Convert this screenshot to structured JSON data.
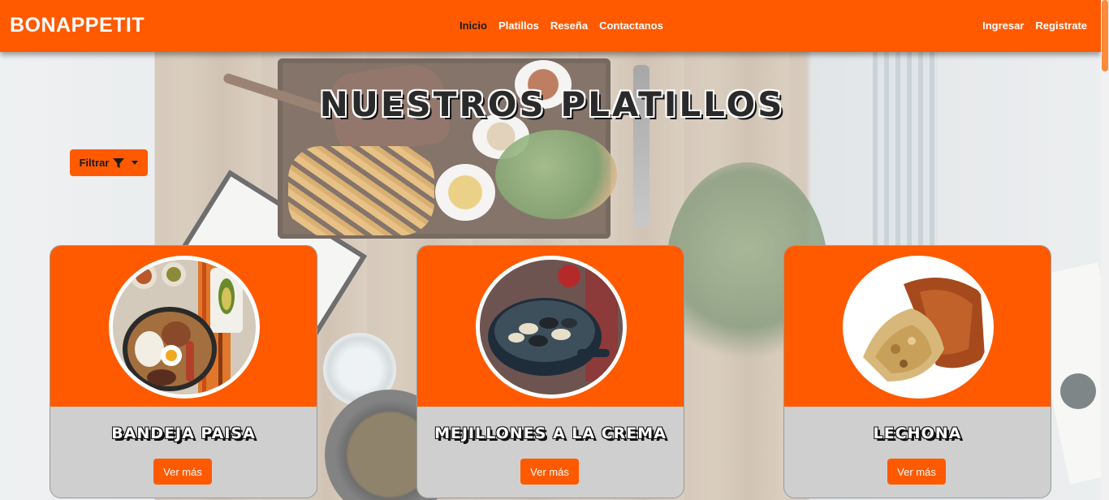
{
  "navbar": {
    "brand": "BONAPPETIT",
    "links": [
      "Inicio",
      "Platillos",
      "Reseña",
      "Contactanos"
    ],
    "active_link": "Inicio",
    "auth": {
      "login": "Ingresar",
      "register": "Registrate"
    }
  },
  "page": {
    "title": "NUESTROS PLATILLOS"
  },
  "filter": {
    "label": "Filtrar",
    "icon": "filter-icon"
  },
  "cards": [
    {
      "title": "BANDEJA PAISA",
      "button": "Ver más"
    },
    {
      "title": "MEJILLONES A LA CREMA",
      "button": "Ver más"
    },
    {
      "title": "LECHONA",
      "button": "Ver más"
    }
  ],
  "colors": {
    "accent": "#ff5a00",
    "card_bg": "#cfcfcf",
    "active_link": "#1b1b1b"
  }
}
